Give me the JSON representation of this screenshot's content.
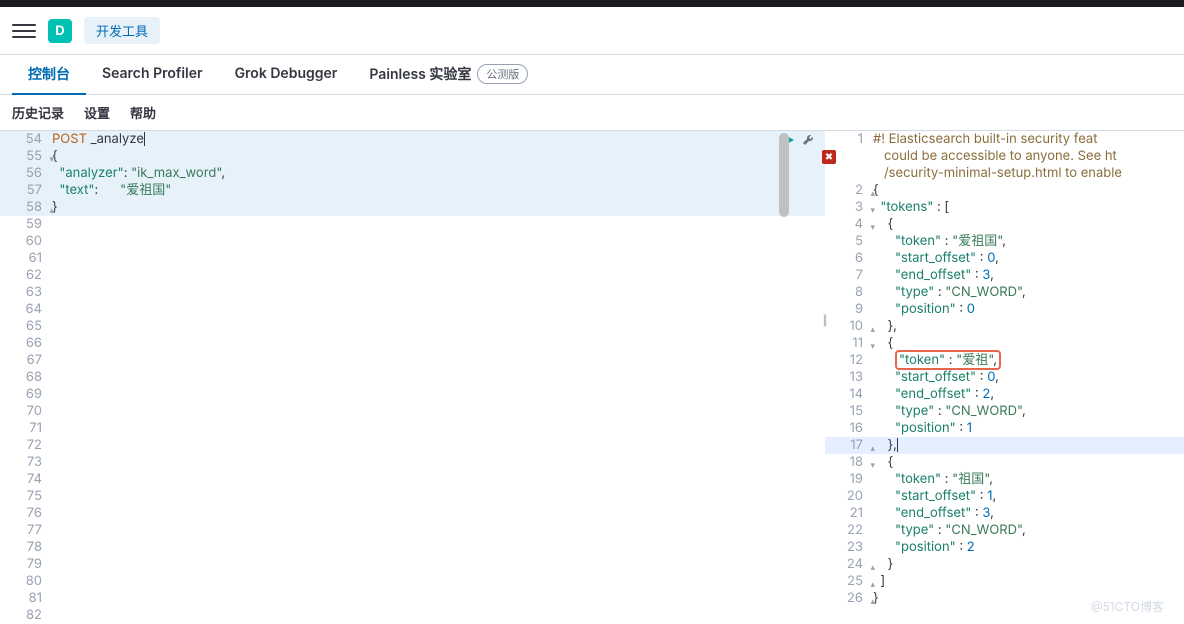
{
  "header": {
    "logo_letter": "D",
    "devtools_label": "开发工具"
  },
  "tabs": {
    "console": "控制台",
    "search_profiler": "Search Profiler",
    "grok_debugger": "Grok Debugger",
    "painless_lab": "Painless 实验室",
    "beta": "公测版"
  },
  "subtabs": {
    "history": "历史记录",
    "settings": "设置",
    "help": "帮助"
  },
  "request": {
    "line_start": 54,
    "lines": [
      {
        "n": 54,
        "pre": "",
        "method": "POST",
        "text": " _analyze",
        "cursor": true
      },
      {
        "n": 55,
        "pre": "{",
        "fold": "▾"
      },
      {
        "n": 56,
        "pre": "  ",
        "key": "\"analyzer\"",
        "mid": ": ",
        "val": "\"ik_max_word\"",
        "post": ","
      },
      {
        "n": 57,
        "pre": "  ",
        "key": "\"text\"",
        "mid": ":      ",
        "val": "\"爱祖国\""
      },
      {
        "n": 58,
        "pre": "}",
        "fold": "▴"
      },
      {
        "n": 59
      },
      {
        "n": 60
      },
      {
        "n": 61
      },
      {
        "n": 62
      },
      {
        "n": 63
      },
      {
        "n": 64
      },
      {
        "n": 65
      },
      {
        "n": 66
      },
      {
        "n": 67
      },
      {
        "n": 68
      },
      {
        "n": 69
      },
      {
        "n": 70
      },
      {
        "n": 71
      },
      {
        "n": 72
      },
      {
        "n": 73
      },
      {
        "n": 74
      },
      {
        "n": 75
      },
      {
        "n": 76
      },
      {
        "n": 77
      },
      {
        "n": 78
      },
      {
        "n": 79
      },
      {
        "n": 80
      },
      {
        "n": 81
      },
      {
        "n": 82
      }
    ]
  },
  "response": {
    "warning_l1": "#! Elasticsearch built-in security feat",
    "warning_l2": "   could be accessible to anyone. See ht",
    "warning_l3": "   /security-minimal-setup.html to enable",
    "lines": [
      {
        "n": 1
      },
      {
        "n": 2,
        "pre": "{",
        "fold": "▴"
      },
      {
        "n": 3,
        "pre": "  ",
        "key": "\"tokens\"",
        "mid": " : [",
        "fold": "▾"
      },
      {
        "n": 4,
        "pre": "    {",
        "fold": "▾"
      },
      {
        "n": 5,
        "pre": "      ",
        "key": "\"token\"",
        "mid": " : ",
        "val": "\"爱祖国\"",
        "post": ","
      },
      {
        "n": 6,
        "pre": "      ",
        "key": "\"start_offset\"",
        "mid": " : ",
        "num": "0",
        "post": ","
      },
      {
        "n": 7,
        "pre": "      ",
        "key": "\"end_offset\"",
        "mid": " : ",
        "num": "3",
        "post": ","
      },
      {
        "n": 8,
        "pre": "      ",
        "key": "\"type\"",
        "mid": " : ",
        "val": "\"CN_WORD\"",
        "post": ","
      },
      {
        "n": 9,
        "pre": "      ",
        "key": "\"position\"",
        "mid": " : ",
        "num": "0"
      },
      {
        "n": 10,
        "pre": "    },",
        "fold": "▴"
      },
      {
        "n": 11,
        "pre": "    {",
        "fold": "▾"
      },
      {
        "n": 12,
        "pre": "      ",
        "boxed": true,
        "key": "\"token\"",
        "mid": " : ",
        "val": "\"爱祖\"",
        "post": ","
      },
      {
        "n": 13,
        "pre": "      ",
        "key": "\"start_offset\"",
        "mid": " : ",
        "num": "0",
        "post": ","
      },
      {
        "n": 14,
        "pre": "      ",
        "key": "\"end_offset\"",
        "mid": " : ",
        "num": "2",
        "post": ","
      },
      {
        "n": 15,
        "pre": "      ",
        "key": "\"type\"",
        "mid": " : ",
        "val": "\"CN_WORD\"",
        "post": ","
      },
      {
        "n": 16,
        "pre": "      ",
        "key": "\"position\"",
        "mid": " : ",
        "num": "1"
      },
      {
        "n": 17,
        "pre": "    },",
        "sel": true,
        "cursor": true,
        "fold": "▴"
      },
      {
        "n": 18,
        "pre": "    {",
        "fold": "▾"
      },
      {
        "n": 19,
        "pre": "      ",
        "key": "\"token\"",
        "mid": " : ",
        "val": "\"祖国\"",
        "post": ","
      },
      {
        "n": 20,
        "pre": "      ",
        "key": "\"start_offset\"",
        "mid": " : ",
        "num": "1",
        "post": ","
      },
      {
        "n": 21,
        "pre": "      ",
        "key": "\"end_offset\"",
        "mid": " : ",
        "num": "3",
        "post": ","
      },
      {
        "n": 22,
        "pre": "      ",
        "key": "\"type\"",
        "mid": " : ",
        "val": "\"CN_WORD\"",
        "post": ","
      },
      {
        "n": 23,
        "pre": "      ",
        "key": "\"position\"",
        "mid": " : ",
        "num": "2"
      },
      {
        "n": 24,
        "pre": "    }",
        "fold": "▴"
      },
      {
        "n": 25,
        "pre": "  ]",
        "fold": "▴"
      },
      {
        "n": 26,
        "pre": "}",
        "fold": "▴"
      }
    ]
  },
  "watermark": "@51CTO博客"
}
